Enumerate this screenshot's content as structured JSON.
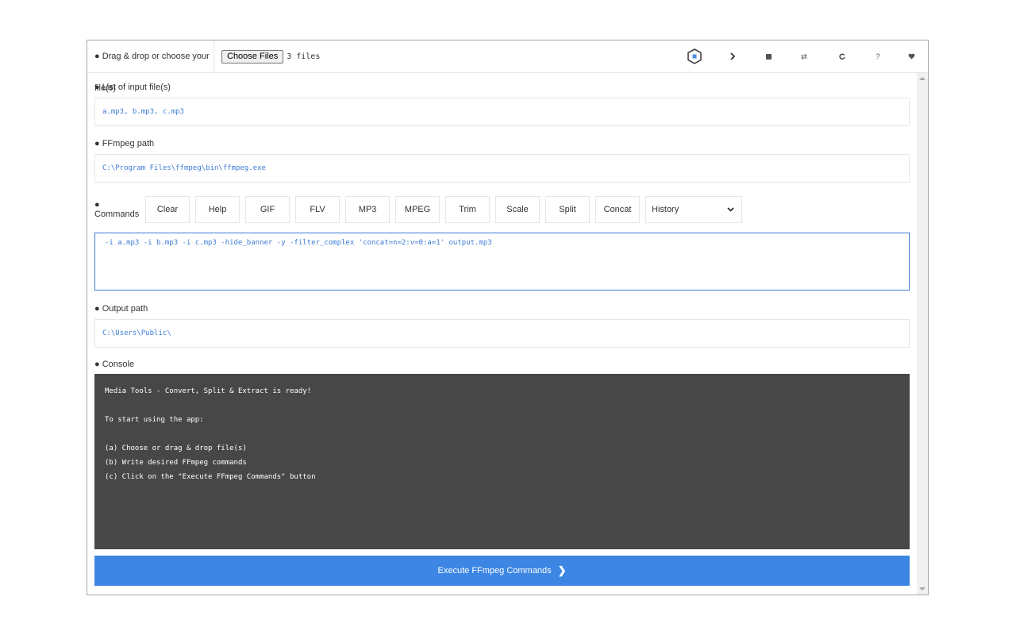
{
  "toolbar": {
    "drop_label": "● Drag & drop or choose your file(s)",
    "choose_label": "Choose Files",
    "file_count": "3 files",
    "icons": [
      {
        "name": "logo-icon",
        "glyph": "⬡"
      },
      {
        "name": "run-icon",
        "glyph": "❯"
      },
      {
        "name": "stop-icon",
        "glyph": "■"
      },
      {
        "name": "repeat-icon",
        "glyph": "⇄"
      },
      {
        "name": "reload-icon",
        "glyph": "↻"
      },
      {
        "name": "help-icon",
        "glyph": "?"
      },
      {
        "name": "heart-icon",
        "glyph": "♥"
      }
    ]
  },
  "inputs": {
    "label": "● List of input file(s)",
    "value": "a.mp3, b.mp3, c.mp3"
  },
  "ffmpeg": {
    "label": "● FFmpeg path",
    "value": "C:\\Program Files\\ffmpeg\\bin\\ffmpeg.exe"
  },
  "commands": {
    "label": "● Commands",
    "buttons": [
      "Clear",
      "Help",
      "GIF",
      "FLV",
      "MP3",
      "MPEG",
      "Trim",
      "Scale",
      "Split",
      "Concat"
    ],
    "history": "History",
    "value": "-i a.mp3 -i b.mp3 -i c.mp3 -hide_banner -y -filter_complex 'concat=n=2:v=0:a=1' output.mp3"
  },
  "output": {
    "label": "● Output path",
    "value": "C:\\Users\\Public\\"
  },
  "console": {
    "label": "● Console",
    "lines": [
      "Media Tools - Convert, Split & Extract is ready!",
      "",
      "To start using the app:",
      "",
      "(a) Choose or drag & drop file(s)",
      "(b) Write desired FFmpeg commands",
      "(c) Click on the \"Execute FFmpeg Commands\" button"
    ]
  },
  "execute": {
    "label": "Execute FFmpeg Commands",
    "chevron": "❯"
  },
  "colors": {
    "accent": "#3d86e4",
    "field_text": "#3d7bd6",
    "console_bg": "#474747"
  }
}
